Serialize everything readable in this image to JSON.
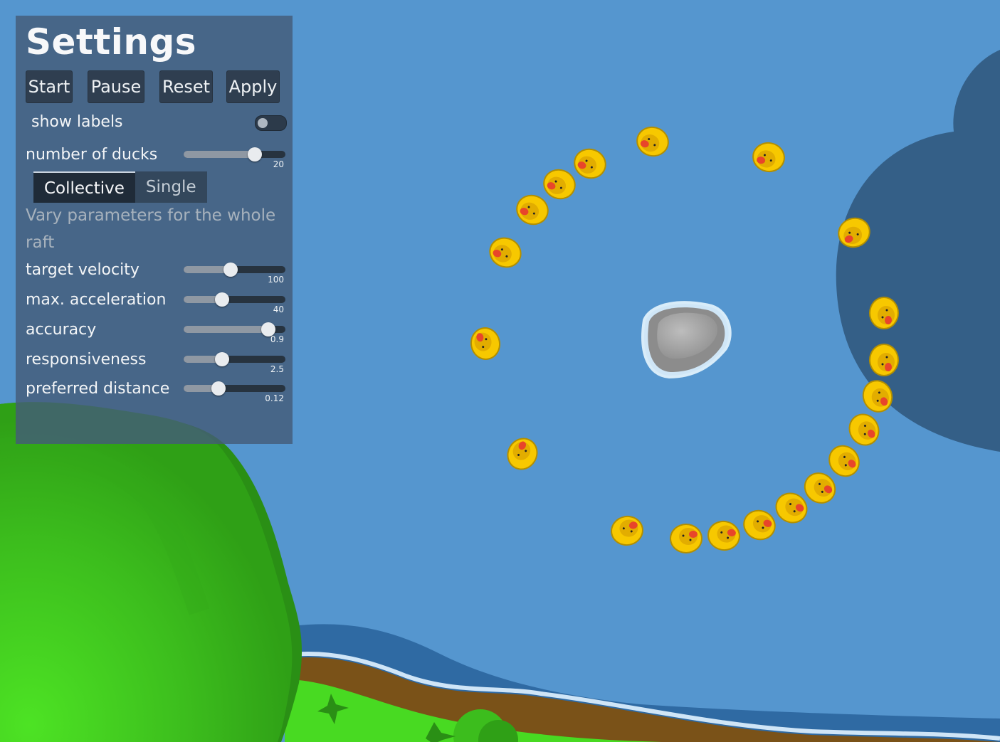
{
  "settings": {
    "title": "Settings",
    "buttons": {
      "start": "Start",
      "pause": "Pause",
      "reset": "Reset",
      "apply": "Apply"
    },
    "show_labels": {
      "label": "show labels",
      "on": false
    },
    "number_of_ducks": {
      "label": "number of ducks",
      "value": "20",
      "fraction": 0.7
    },
    "tabs": {
      "collective": "Collective",
      "single": "Single",
      "active": "Collective"
    },
    "description": "Vary parameters for the whole raft",
    "sliders": [
      {
        "label": "target velocity",
        "value": "100",
        "fraction": 0.46
      },
      {
        "label": "max. acceleration",
        "value": "40",
        "fraction": 0.38
      },
      {
        "label": "accuracy",
        "value": "0.9",
        "fraction": 0.83
      },
      {
        "label": "responsiveness",
        "value": "2.5",
        "fraction": 0.38
      },
      {
        "label": "preferred distance",
        "value": "0.12",
        "fraction": 0.34
      }
    ]
  },
  "scene": {
    "water_color": "#5596cf",
    "shadow_color": "#345f87",
    "grass_color": "#37b219",
    "ducks_count": 20
  }
}
